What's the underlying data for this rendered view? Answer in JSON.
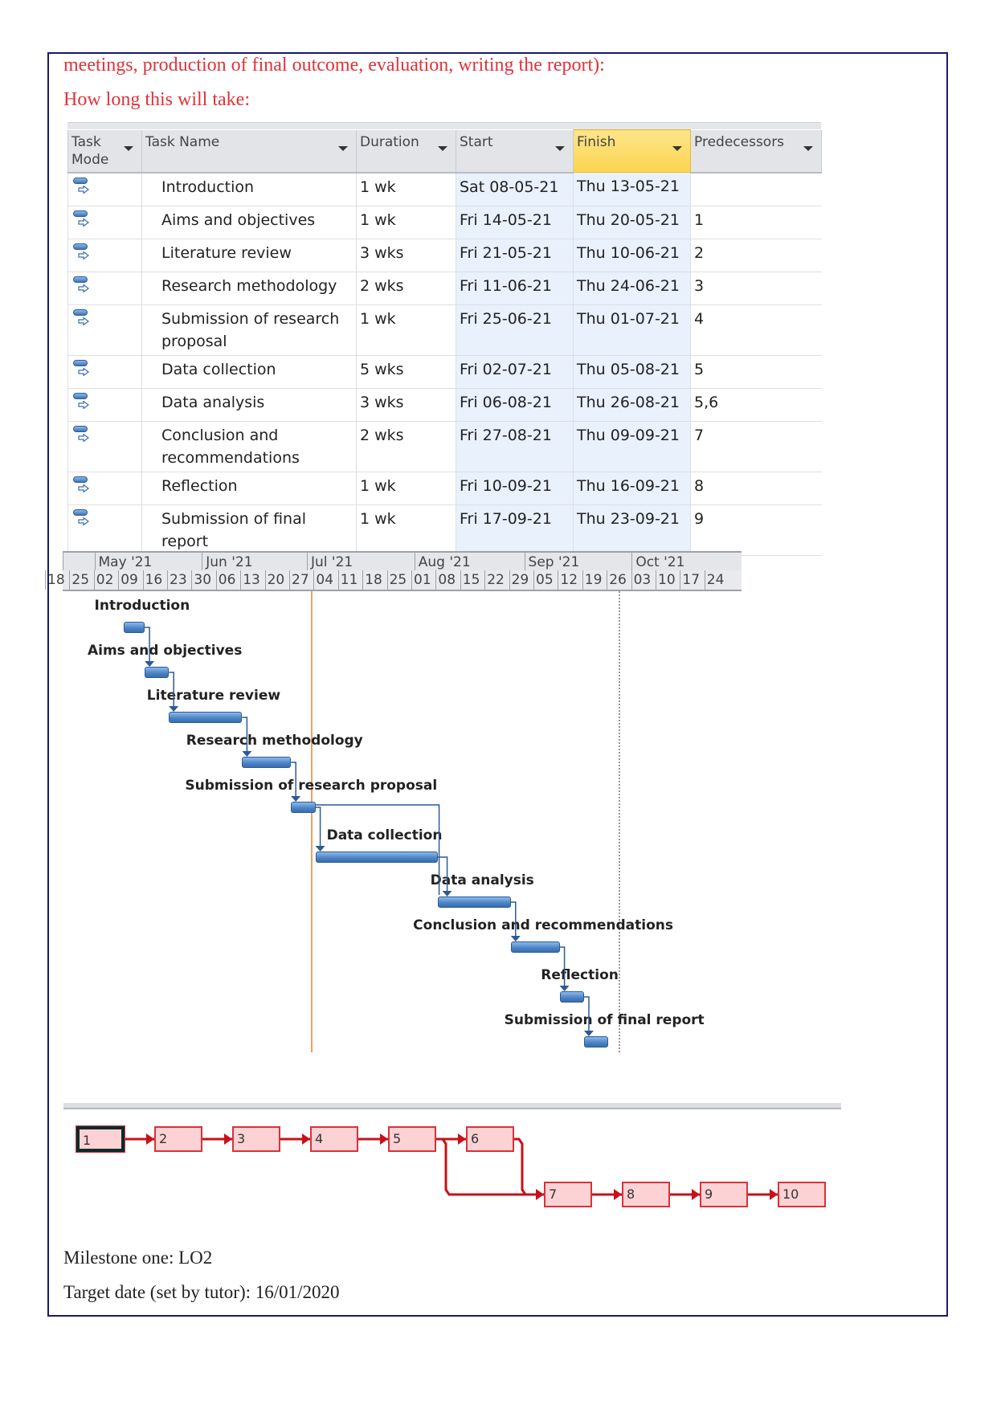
{
  "document": {
    "intro_line": "meetings, production of final outcome, evaluation, writing the report):",
    "duration_heading": "How long this will take:",
    "milestone_line": "Milestone  one: LO2",
    "target_line": "Target date (set by tutor):  16/01/2020"
  },
  "task_table": {
    "columns": {
      "mode": "Task Mode",
      "name": "Task Name",
      "duration": "Duration",
      "start": "Start",
      "finish": "Finish",
      "predecessors": "Predecessors"
    },
    "rows": [
      {
        "mode_icon": "auto-scheduled-task-icon",
        "name": "Introduction",
        "duration": "1 wk",
        "start": "Sat 08-05-21",
        "finish": "Thu 13-05-21",
        "predecessors": ""
      },
      {
        "mode_icon": "auto-scheduled-task-icon",
        "name": "Aims and objectives",
        "duration": "1 wk",
        "start": "Fri 14-05-21",
        "finish": "Thu 20-05-21",
        "predecessors": "1"
      },
      {
        "mode_icon": "auto-scheduled-task-icon",
        "name": "Literature review",
        "duration": "3 wks",
        "start": "Fri 21-05-21",
        "finish": "Thu 10-06-21",
        "predecessors": "2"
      },
      {
        "mode_icon": "auto-scheduled-task-icon",
        "name": "Research methodology",
        "duration": "2 wks",
        "start": "Fri 11-06-21",
        "finish": "Thu 24-06-21",
        "predecessors": "3"
      },
      {
        "mode_icon": "auto-scheduled-task-icon",
        "name": "Submission of research proposal",
        "duration": "1 wk",
        "start": "Fri 25-06-21",
        "finish": "Thu 01-07-21",
        "predecessors": "4"
      },
      {
        "mode_icon": "auto-scheduled-task-icon",
        "name": "Data collection",
        "duration": "5 wks",
        "start": "Fri 02-07-21",
        "finish": "Thu 05-08-21",
        "predecessors": "5"
      },
      {
        "mode_icon": "auto-scheduled-task-icon",
        "name": "Data analysis",
        "duration": "3 wks",
        "start": "Fri 06-08-21",
        "finish": "Thu 26-08-21",
        "predecessors": "5,6"
      },
      {
        "mode_icon": "auto-scheduled-task-icon",
        "name": "Conclusion and recommendations",
        "duration": "2 wks",
        "start": "Fri 27-08-21",
        "finish": "Thu 09-09-21",
        "predecessors": "7"
      },
      {
        "mode_icon": "auto-scheduled-task-icon",
        "name": "Reflection",
        "duration": "1 wk",
        "start": "Fri 10-09-21",
        "finish": "Thu 16-09-21",
        "predecessors": "8"
      },
      {
        "mode_icon": "auto-scheduled-task-icon",
        "name": "Submission of final report",
        "duration": "1 wk",
        "start": "Fri 17-09-21",
        "finish": "Thu 23-09-21",
        "predecessors": "9"
      }
    ]
  },
  "gantt": {
    "months": [
      "",
      "May '21",
      "Jun '21",
      "Jul '21",
      "Aug '21",
      "Sep '21",
      "Oct '21"
    ],
    "weeks": [
      "18",
      "25",
      "02",
      "09",
      "16",
      "23",
      "30",
      "06",
      "13",
      "20",
      "27",
      "04",
      "11",
      "18",
      "25",
      "01",
      "08",
      "15",
      "22",
      "29",
      "05",
      "12",
      "19",
      "26",
      "03",
      "10",
      "17",
      "24"
    ],
    "bars": [
      {
        "label": "Introduction",
        "start_week": 2.86,
        "duration_weeks": 0.86
      },
      {
        "label": "Aims and objectives",
        "start_week": 3.71,
        "duration_weeks": 1.0
      },
      {
        "label": "Literature review",
        "start_week": 4.71,
        "duration_weeks": 3.0
      },
      {
        "label": "Research methodology",
        "start_week": 7.71,
        "duration_weeks": 2.0
      },
      {
        "label": "Submission of research proposal",
        "start_week": 9.71,
        "duration_weeks": 1.0
      },
      {
        "label": "Data collection",
        "start_week": 10.71,
        "duration_weeks": 5.0
      },
      {
        "label": "Data analysis",
        "start_week": 15.71,
        "duration_weeks": 3.0
      },
      {
        "label": "Conclusion and recommendations",
        "start_week": 18.71,
        "duration_weeks": 2.0
      },
      {
        "label": "Reflection",
        "start_week": 20.71,
        "duration_weeks": 1.0
      },
      {
        "label": "Submission of final report",
        "start_week": 21.71,
        "duration_weeks": 1.0
      }
    ],
    "links": [
      [
        0,
        1
      ],
      [
        1,
        2
      ],
      [
        2,
        3
      ],
      [
        3,
        4
      ],
      [
        4,
        5
      ],
      [
        4,
        6
      ],
      [
        5,
        6
      ],
      [
        6,
        7
      ],
      [
        7,
        8
      ],
      [
        8,
        9
      ]
    ],
    "today_week": 10.1,
    "status_week": 22.7
  },
  "network": {
    "nodes": [
      "1",
      "2",
      "3",
      "4",
      "5",
      "6",
      "7",
      "8",
      "9",
      "10"
    ],
    "selected": "1",
    "links": [
      [
        1,
        2
      ],
      [
        2,
        3
      ],
      [
        3,
        4
      ],
      [
        4,
        5
      ],
      [
        5,
        6
      ],
      [
        5,
        7
      ],
      [
        6,
        7
      ],
      [
        7,
        8
      ],
      [
        8,
        9
      ],
      [
        9,
        10
      ]
    ]
  }
}
